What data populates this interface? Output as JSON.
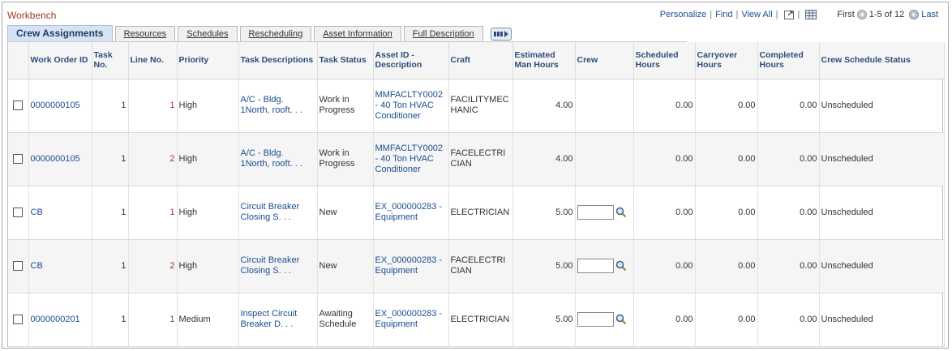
{
  "grid": {
    "title": "Workbench",
    "nav": {
      "personalize": "Personalize",
      "find": "Find",
      "view_all": "View All",
      "first": "First",
      "range": "1-5 of 12",
      "last": "Last"
    }
  },
  "tabs": [
    {
      "label": "Crew Assignments",
      "active": true
    },
    {
      "label": "Resources"
    },
    {
      "label": "Schedules"
    },
    {
      "label": "Rescheduling"
    },
    {
      "label": "Asset Information"
    },
    {
      "label": "Full Description"
    }
  ],
  "columns": {
    "work_order": "Work Order ID",
    "task_no": "Task No.",
    "line_no": "Line No.",
    "priority": "Priority",
    "task_desc": "Task Descriptions",
    "task_status": "Task Status",
    "asset": "Asset ID - Description",
    "craft": "Craft",
    "est_hours": "Estimated Man Hours",
    "crew": "Crew",
    "sched_hours": "Scheduled Hours",
    "carry_hours": "Carryover Hours",
    "comp_hours": "Completed Hours",
    "crew_status": "Crew Schedule Status"
  },
  "rows": [
    {
      "work_order": "0000000105",
      "task_no": "1",
      "line_no": "1",
      "priority": "High",
      "task_desc": "A/C - Bldg. 1North, rooft. . .",
      "task_status": "Work in Progress",
      "asset": "MMFACLTY0002 - 40 Ton HVAC Conditioner",
      "craft": "FACILITYMECHANIC",
      "est_hours": "4.00",
      "sched_hours": "0.00",
      "carry_hours": "0.00",
      "comp_hours": "0.00",
      "crew_status": "Unscheduled"
    },
    {
      "work_order": "0000000105",
      "task_no": "1",
      "line_no": "2",
      "priority": "High",
      "task_desc": "A/C - Bldg. 1North, rooft. . .",
      "task_status": "Work in Progress",
      "asset": "MMFACLTY0002 - 40 Ton HVAC Conditioner",
      "craft": "FACELECTRICIAN",
      "est_hours": "4.00",
      "sched_hours": "0.00",
      "carry_hours": "0.00",
      "comp_hours": "0.00",
      "crew_status": "Unscheduled"
    },
    {
      "work_order": "CB",
      "task_no": "1",
      "line_no": "1",
      "priority": "High",
      "task_desc": "Circuit Breaker Closing S. . .",
      "task_status": "New",
      "asset": "EX_000000283 - Equipment",
      "craft": "ELECTRICIAN",
      "est_hours": "5.00",
      "sched_hours": "0.00",
      "carry_hours": "0.00",
      "comp_hours": "0.00",
      "crew_status": "Unscheduled"
    },
    {
      "work_order": "CB",
      "task_no": "1",
      "line_no": "2",
      "priority": "High",
      "task_desc": "Circuit Breaker Closing S. . .",
      "task_status": "New",
      "asset": "EX_000000283 - Equipment",
      "craft": "FACELECTRICIAN",
      "est_hours": "5.00",
      "sched_hours": "0.00",
      "carry_hours": "0.00",
      "comp_hours": "0.00",
      "crew_status": "Unscheduled"
    },
    {
      "work_order": "0000000201",
      "task_no": "1",
      "line_no": "1",
      "priority": "Medium",
      "task_desc": "Inspect Circuit Breaker D. . .",
      "task_status": "Awaiting Schedule",
      "asset": "EX_000000283 - Equipment",
      "craft": "ELECTRICIAN",
      "est_hours": "5.00",
      "sched_hours": "0.00",
      "carry_hours": "0.00",
      "comp_hours": "0.00",
      "crew_status": "Unscheduled"
    }
  ]
}
